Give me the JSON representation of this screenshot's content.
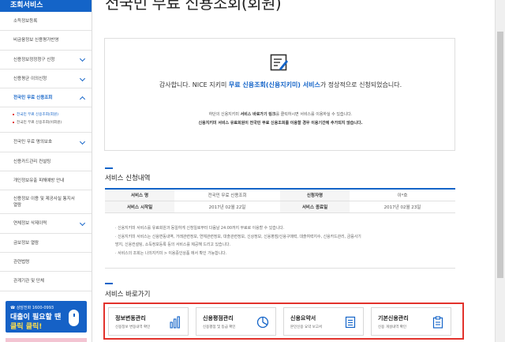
{
  "sidebar": {
    "header": "조회서비스",
    "items": [
      {
        "label": "소득정보등록"
      },
      {
        "label": "비금융정보 신용평가반영"
      },
      {
        "label": "신용정보정정청구 신청"
      },
      {
        "label": "신용평균 이의신청"
      },
      {
        "label": "전국민 무료 신용조회"
      },
      {
        "label": "전국민 무료 명의보호"
      },
      {
        "label": "신용카드관리 컨설팅"
      },
      {
        "label": "개인정보유출 피해예방 안내"
      },
      {
        "label": "신용정보 이용 및 제공사실 통지서열람"
      },
      {
        "label": "연체정보 삭제이력"
      },
      {
        "label": "금보정보 열람"
      },
      {
        "label": "관련법령"
      },
      {
        "label": "관계기관 및 단체"
      }
    ],
    "sub_items": [
      {
        "label": "전국민 무료 신용조회(회원)"
      },
      {
        "label": "전국민 무료 신용조회(비회원)"
      }
    ],
    "banner": {
      "phone": "☎ 상담전화 1600-0993",
      "line1": "대출이 필요할 땐",
      "line2": "클릭 클릭!"
    }
  },
  "header": {
    "title_fragment": "전국민 무료 신용조회(회원)"
  },
  "confirm": {
    "msg_prefix": "감사합니다. NICE 지키미 ",
    "msg_highlight": "무료 신용조회(신용지키미) 서비스",
    "msg_suffix": "가 정상적으로 신청되었습니다.",
    "sub1_prefix": "하단의 신용지키미 ",
    "sub1_bold": "서비스 바로가기 링크",
    "sub1_suffix": "를 클릭하시면 서비스를 이용하실 수 있습니다.",
    "sub2_bold1": "신용지키미 서비스 유료회원",
    "sub2_middle": "이 전국민 무료 신용조회를 이용할 경우 ",
    "sub2_bold2": "이용기간에 추가되지 않습니다."
  },
  "service": {
    "section_title": "서비스 신청내역",
    "rows": [
      {
        "h1": "서비스 명",
        "v1": "전국민 무료 신용조회",
        "h2": "신청자명",
        "v2": "이*호"
      },
      {
        "h1": "서비스 시작일",
        "v1": "2017년 02월 22일",
        "h2": "서비스 종료일",
        "v2": "2017년 02월 23일"
      }
    ],
    "notes": [
      "· 신용지키미 서비스를 유료회원과 동일하게 신청일로부터 다음날 24:00까지 무료로 이용할 수 있습니다.",
      "· 신용지키미 서비스는 신용변동내역, 거래관련정보, 연체관련정보, 대출관련정보, 신상정보, 신용평점/신용구매력, 대출여력지수, 신용카드관리, 금융사기",
      "  방지, 신용컨설팅, 소득정보등록 등의 서비스를 제공해 드리고 있습니다.",
      "· 서비스의 조회는 나의지키미 > 이용중인상품 에서 확인 가능합니다."
    ]
  },
  "shortcuts": {
    "section_title": "서비스 바로가기",
    "items": [
      {
        "title": "정보변동관리",
        "desc": "신용정보 변동내역 확인",
        "icon": "bar-chart-icon"
      },
      {
        "title": "신용평점관리",
        "desc": "신용평점 및 등급 확인",
        "icon": "pie-chart-icon"
      },
      {
        "title": "신용요약서",
        "desc": "본인신용 요약 보고서",
        "icon": "document-icon"
      },
      {
        "title": "기본신용관리",
        "desc": "신용 개설내역 확인",
        "icon": "clipboard-icon"
      }
    ]
  },
  "colors": {
    "brand_blue": "#1464c8",
    "highlight_red": "#e2322c"
  }
}
